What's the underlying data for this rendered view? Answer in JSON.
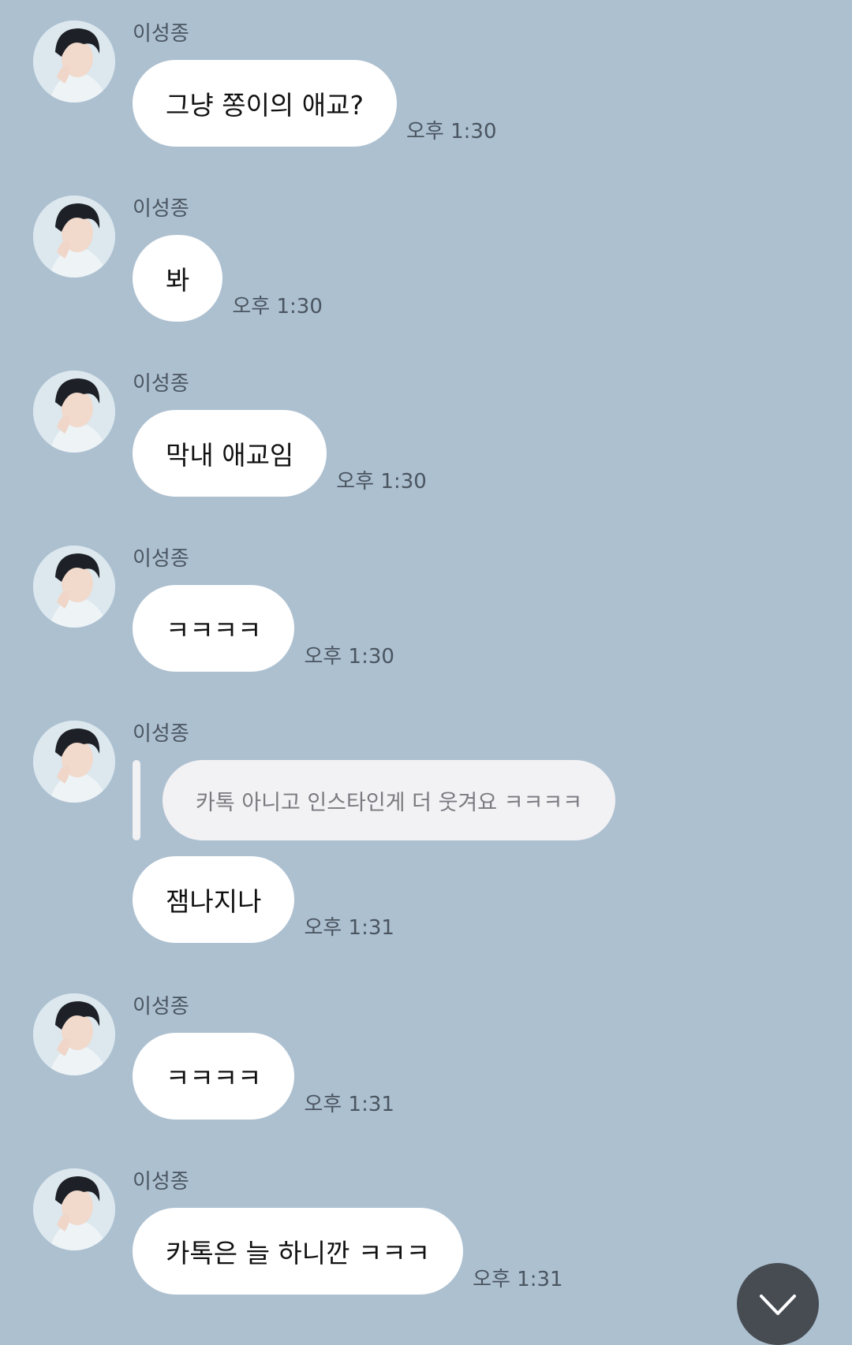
{
  "messages": [
    {
      "sender": "이성종",
      "text": "그냥 쫑이의 애교?",
      "time": "오후 1:30"
    },
    {
      "sender": "이성종",
      "text": "봐",
      "time": "오후 1:30"
    },
    {
      "sender": "이성종",
      "text": "막내 애교임",
      "time": "오후 1:30"
    },
    {
      "sender": "이성종",
      "text": "ㅋㅋㅋㅋ",
      "time": "오후 1:30"
    },
    {
      "sender": "이성종",
      "quote": "카톡 아니고 인스타인게 더 웃겨요 ㅋㅋㅋㅋ",
      "text": "잼나지나",
      "time": "오후 1:31"
    },
    {
      "sender": "이성종",
      "text": "ㅋㅋㅋㅋ",
      "time": "오후 1:31"
    },
    {
      "sender": "이성종",
      "text": "카톡은 늘 하니깐 ㅋㅋㅋ",
      "time": "오후 1:31"
    }
  ],
  "icons": {
    "scroll_down": "chevron-down-icon",
    "avatar": "profile-photo"
  },
  "colors": {
    "background": "#adc0d0",
    "bubble": "#ffffff",
    "quote_bubble": "#f2f1f4",
    "scroll_button": "#474c53"
  }
}
